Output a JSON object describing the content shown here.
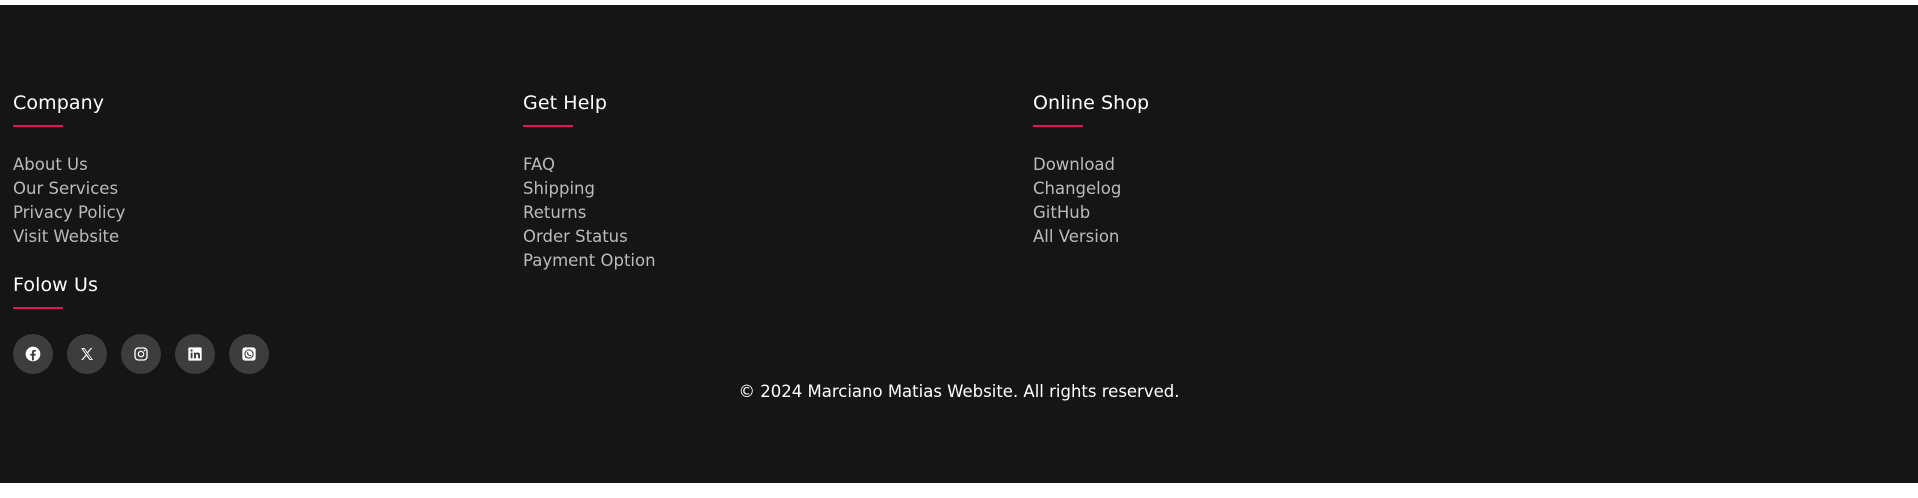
{
  "columns": [
    {
      "heading": "Company",
      "links": [
        "About Us",
        "Our Services",
        "Privacy Policy",
        "Visit Website"
      ]
    },
    {
      "heading": "Get Help",
      "links": [
        "FAQ",
        "Shipping",
        "Returns",
        "Order Status",
        "Payment Option"
      ]
    },
    {
      "heading": "Online Shop",
      "links": [
        "Download",
        "Changelog",
        "GitHub",
        "All Version"
      ]
    }
  ],
  "follow": {
    "heading": "Folow Us",
    "icons": [
      "facebook-icon",
      "x-icon",
      "instagram-icon",
      "linkedin-icon",
      "whatsapp-icon"
    ]
  },
  "copyright": "© 2024 Marciano Matias Website. All rights reserved.",
  "colors": {
    "background": "#151515",
    "accent": "#e0185a",
    "link": "#bbbbbb",
    "heading": "#ffffff",
    "social_bg": "#3d3d3d"
  }
}
